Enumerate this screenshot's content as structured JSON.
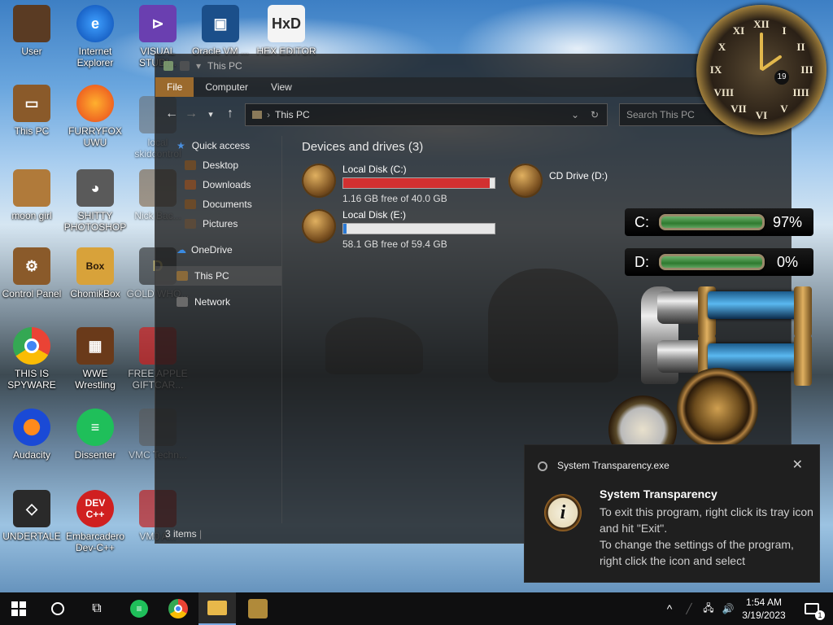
{
  "desktop": {
    "icons": [
      {
        "label": "User",
        "color": "#5a3b23"
      },
      {
        "label": "Internet Explorer",
        "color": "#2a7ad6"
      },
      {
        "label": "VISUAL STUDI...",
        "color": "#6a3fb0"
      },
      {
        "label": "Oracle VM ...",
        "color": "#1b4f8a"
      },
      {
        "label": "HEX EDITOR",
        "color": "#d8a23a"
      },
      {
        "label": "This PC",
        "color": "#8a5a2a"
      },
      {
        "label": "FURRYFOX UWU",
        "color": "#e8741c"
      },
      {
        "label": "local skidcontrol",
        "color": "#6a6a6a"
      },
      {
        "label": "moon girl",
        "color": "#b07a3a"
      },
      {
        "label": "SHITTY PHOTOSHOP",
        "color": "#5a5a5a"
      },
      {
        "label": "Nick Bac...",
        "color": "#7a5530"
      },
      {
        "label": "Control Panel",
        "color": "#8a5a2a"
      },
      {
        "label": "ChomikBox",
        "color": "#d8a23a"
      },
      {
        "label": "GOLD WHO...",
        "color": "#222222"
      },
      {
        "label": "THIS IS SPYWARE",
        "color": "#2a9a3a"
      },
      {
        "label": "WWE Wrestling",
        "color": "#6a3a1a"
      },
      {
        "label": "FREE APPLE GIFTCAR...",
        "color": "#d02020"
      },
      {
        "label": "Audacity",
        "color": "#1a4ad6"
      },
      {
        "label": "Dissenter",
        "color": "#1fbf5a"
      },
      {
        "label": "VMC Techn...",
        "color": "#5a5a5a"
      },
      {
        "label": "UNDERTALE",
        "color": "#2a2a2a"
      },
      {
        "label": "Embarcadero Dev-C++",
        "color": "#d02020"
      },
      {
        "label": "VM0 A...",
        "color": "#c02020"
      }
    ]
  },
  "explorer": {
    "title": "This PC",
    "ribbon_tabs": [
      "File",
      "Computer",
      "View"
    ],
    "address_path": "This PC",
    "search_placeholder": "Search This PC",
    "nav": {
      "quick_access": "Quick access",
      "desktop": "Desktop",
      "downloads": "Downloads",
      "documents": "Documents",
      "pictures": "Pictures",
      "onedrive": "OneDrive",
      "this_pc": "This PC",
      "network": "Network"
    },
    "group_header": "Devices and drives (3)",
    "drives": [
      {
        "name": "Local Disk (C:)",
        "free": "1.16 GB free of 40.0 GB",
        "used_fraction": 0.97,
        "bar_color": "#d23030"
      },
      {
        "name": "Local Disk (E:)",
        "free": "58.1 GB free of 59.4 GB",
        "used_fraction": 0.02,
        "bar_color": "#2a7ad6"
      },
      {
        "name": "CD Drive (D:)"
      }
    ],
    "status": "3 items"
  },
  "widgets": {
    "clock": {
      "numerals": [
        "XII",
        "I",
        "II",
        "III",
        "IIII",
        "V",
        "VI",
        "VII",
        "VIII",
        "IX",
        "X",
        "XI"
      ],
      "date": "19"
    },
    "meters": [
      {
        "label": "C:",
        "value": "97%"
      },
      {
        "label": "D:",
        "value": "0%"
      }
    ]
  },
  "notification": {
    "app": "System Transparency.exe",
    "title": "System Transparency",
    "line1": "To exit this program, right click its tray icon and hit \"Exit\".",
    "line2": "To change the settings of the program, right click the icon and select"
  },
  "taskbar": {
    "time": "1:54 AM",
    "date": "3/19/2023",
    "notification_count": "1"
  }
}
